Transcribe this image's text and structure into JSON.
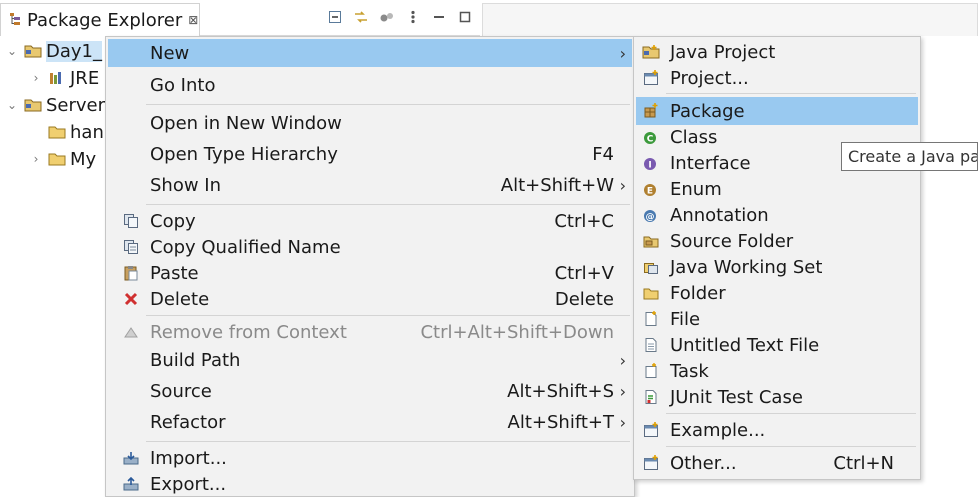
{
  "explorer": {
    "title": "Package Explorer",
    "close_glyph": "⊠",
    "toolbar": [
      "collapse-all-icon",
      "link-with-editor-icon",
      "filters-icon",
      "view-menu-icon",
      "minimize-icon",
      "maximize-icon"
    ],
    "tree": [
      {
        "label": "Day1_",
        "icon": "project-folder-icon",
        "expanded": true,
        "selected": true
      },
      {
        "label": "JRE",
        "icon": "library-icon",
        "expanded": false
      },
      {
        "label": "Server",
        "icon": "project-folder-icon",
        "expanded": true
      },
      {
        "label": "han",
        "icon": "folder-icon"
      },
      {
        "label": "My",
        "icon": "folder-icon",
        "expanded": false
      }
    ]
  },
  "context_menu": {
    "items": [
      {
        "label": "New",
        "accel": "",
        "submenu": true,
        "highlighted": true
      },
      {
        "label": "Go Into",
        "accel": ""
      },
      {
        "label": "Open in New Window",
        "accel": ""
      },
      {
        "label": "Open Type Hierarchy",
        "accel": "F4"
      },
      {
        "label": "Show In",
        "accel": "Alt+Shift+W",
        "submenu": true
      },
      {
        "label": "Copy",
        "accel": "Ctrl+C",
        "icon": "copy-icon"
      },
      {
        "label": "Copy Qualified Name",
        "accel": "",
        "icon": "copy-qualified-icon"
      },
      {
        "label": "Paste",
        "accel": "Ctrl+V",
        "icon": "paste-icon"
      },
      {
        "label": "Delete",
        "accel": "Delete",
        "icon": "delete-icon"
      },
      {
        "label": "Remove from Context",
        "accel": "Ctrl+Alt+Shift+Down",
        "disabled": true,
        "icon": "remove-context-icon"
      },
      {
        "label": "Build Path",
        "accel": "",
        "submenu": true
      },
      {
        "label": "Source",
        "accel": "Alt+Shift+S",
        "submenu": true
      },
      {
        "label": "Refactor",
        "accel": "Alt+Shift+T",
        "submenu": true
      },
      {
        "label": "Import...",
        "accel": "",
        "icon": "import-icon"
      },
      {
        "label": "Export...",
        "accel": "",
        "icon": "export-icon"
      }
    ],
    "submenu_arrow": "›"
  },
  "new_submenu": {
    "items": [
      {
        "label": "Java Project",
        "icon": "java-project-icon"
      },
      {
        "label": "Project...",
        "icon": "project-icon"
      },
      {
        "label": "Package",
        "icon": "package-icon",
        "highlighted": true
      },
      {
        "label": "Class",
        "icon": "class-icon"
      },
      {
        "label": "Interface",
        "icon": "interface-icon"
      },
      {
        "label": "Enum",
        "icon": "enum-icon"
      },
      {
        "label": "Annotation",
        "icon": "annotation-icon"
      },
      {
        "label": "Source Folder",
        "icon": "source-folder-icon"
      },
      {
        "label": "Java Working Set",
        "icon": "working-set-icon"
      },
      {
        "label": "Folder",
        "icon": "folder-icon"
      },
      {
        "label": "File",
        "icon": "file-icon"
      },
      {
        "label": "Untitled Text File",
        "icon": "text-file-icon"
      },
      {
        "label": "Task",
        "icon": "task-icon"
      },
      {
        "label": "JUnit Test Case",
        "icon": "junit-icon"
      },
      {
        "label": "Example...",
        "icon": "example-icon"
      },
      {
        "label": "Other...",
        "accel": "Ctrl+N",
        "icon": "other-icon"
      }
    ]
  },
  "tooltip": {
    "text": "Create a Java pa"
  },
  "colors": {
    "menu_bg": "#f2f2f2",
    "highlight": "#99c9f0",
    "selection": "#cce4f7",
    "disabled_text": "#8a8a8a"
  }
}
